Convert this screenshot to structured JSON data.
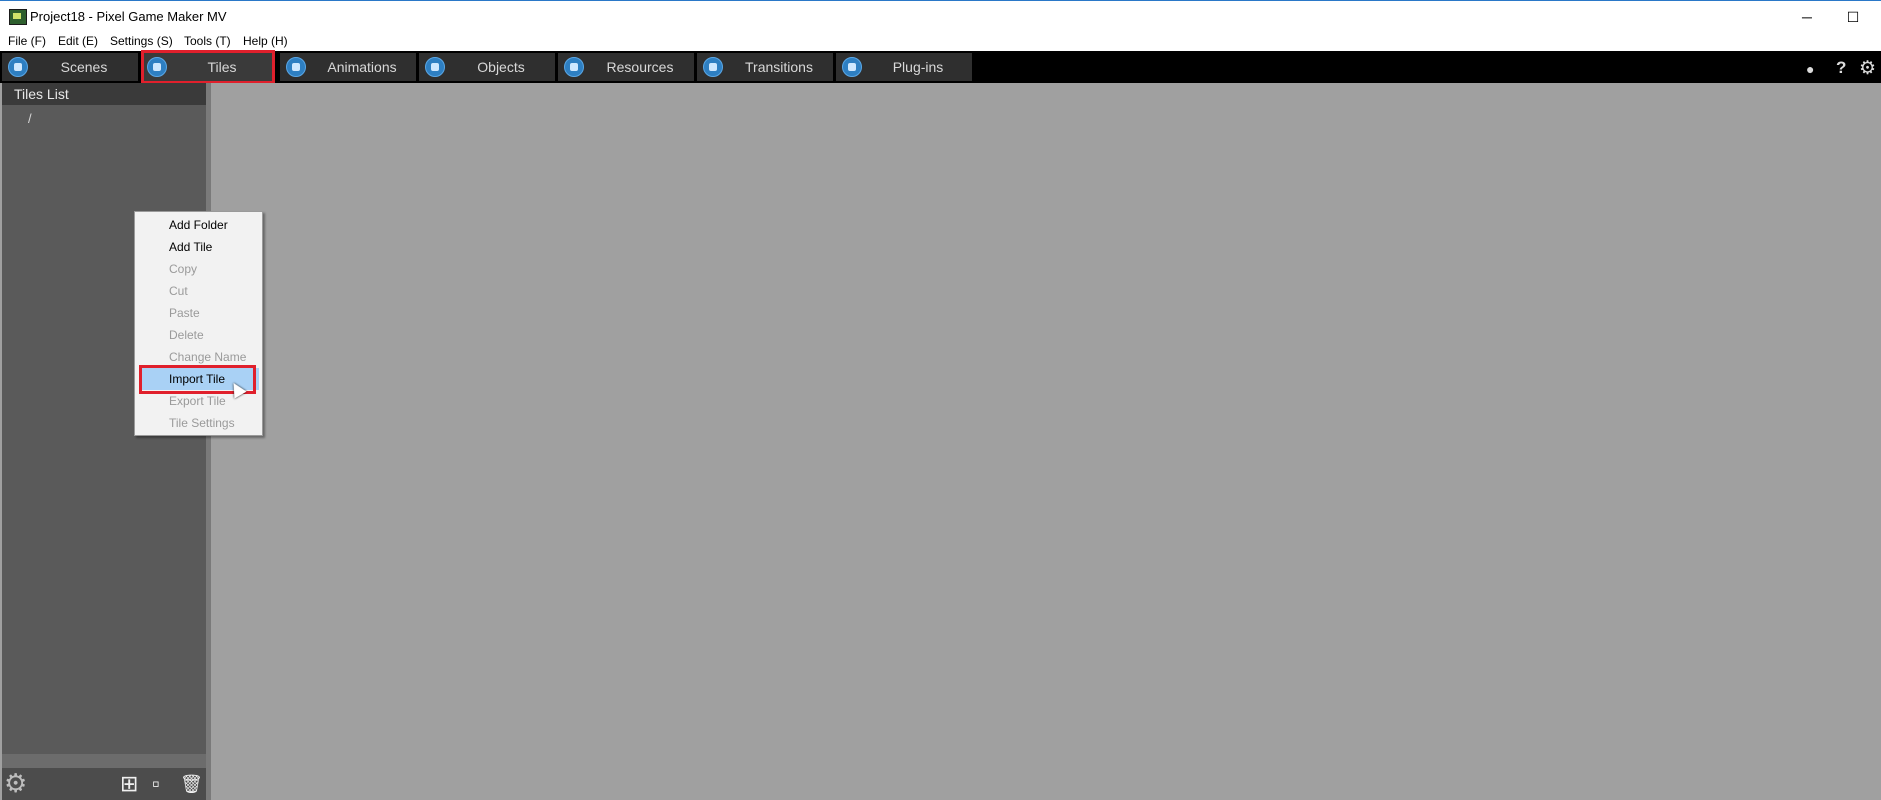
{
  "window": {
    "title": "Project18 - Pixel Game Maker MV",
    "minimize_glyph": "─",
    "maximize_glyph": "☐"
  },
  "menubar": {
    "items": [
      "File (F)",
      "Edit (E)",
      "Settings (S)",
      "Tools (T)",
      "Help (H)"
    ]
  },
  "tabs": [
    {
      "label": "Scenes",
      "icon": "scenes-icon"
    },
    {
      "label": "Tiles",
      "icon": "tiles-icon",
      "active": true
    },
    {
      "label": "Animations",
      "icon": "animations-icon"
    },
    {
      "label": "Objects",
      "icon": "objects-icon"
    },
    {
      "label": "Resources",
      "icon": "resources-icon"
    },
    {
      "label": "Transitions",
      "icon": "transitions-icon"
    },
    {
      "label": "Plug-ins",
      "icon": "plugins-icon"
    }
  ],
  "toolbar_right": {
    "help_glyph": "?",
    "settings_glyph": "⚙",
    "record_glyph": "●"
  },
  "tiles_panel": {
    "title": "Tiles List",
    "root": "/",
    "bottom_icons": {
      "settings": "⚙",
      "add_folder": "⊞",
      "add_tile": "▫",
      "delete": "🗑"
    }
  },
  "context_menu": {
    "items": [
      {
        "label": "Add Folder",
        "state": "enabled"
      },
      {
        "label": "Add Tile",
        "state": "enabled"
      },
      {
        "label": "Copy",
        "state": "disabled"
      },
      {
        "label": "Cut",
        "state": "disabled"
      },
      {
        "label": "Paste",
        "state": "disabled"
      },
      {
        "label": "Delete",
        "state": "disabled"
      },
      {
        "label": "Change Name",
        "state": "disabled"
      },
      {
        "label": "Import Tile",
        "state": "hover"
      },
      {
        "label": "Export Tile",
        "state": "disabled"
      },
      {
        "label": "Tile Settings",
        "state": "disabled"
      }
    ]
  },
  "colors": {
    "highlight_border": "#e0202c",
    "menu_hover": "#a9d1f5",
    "workspace": "#a0a0a0"
  }
}
